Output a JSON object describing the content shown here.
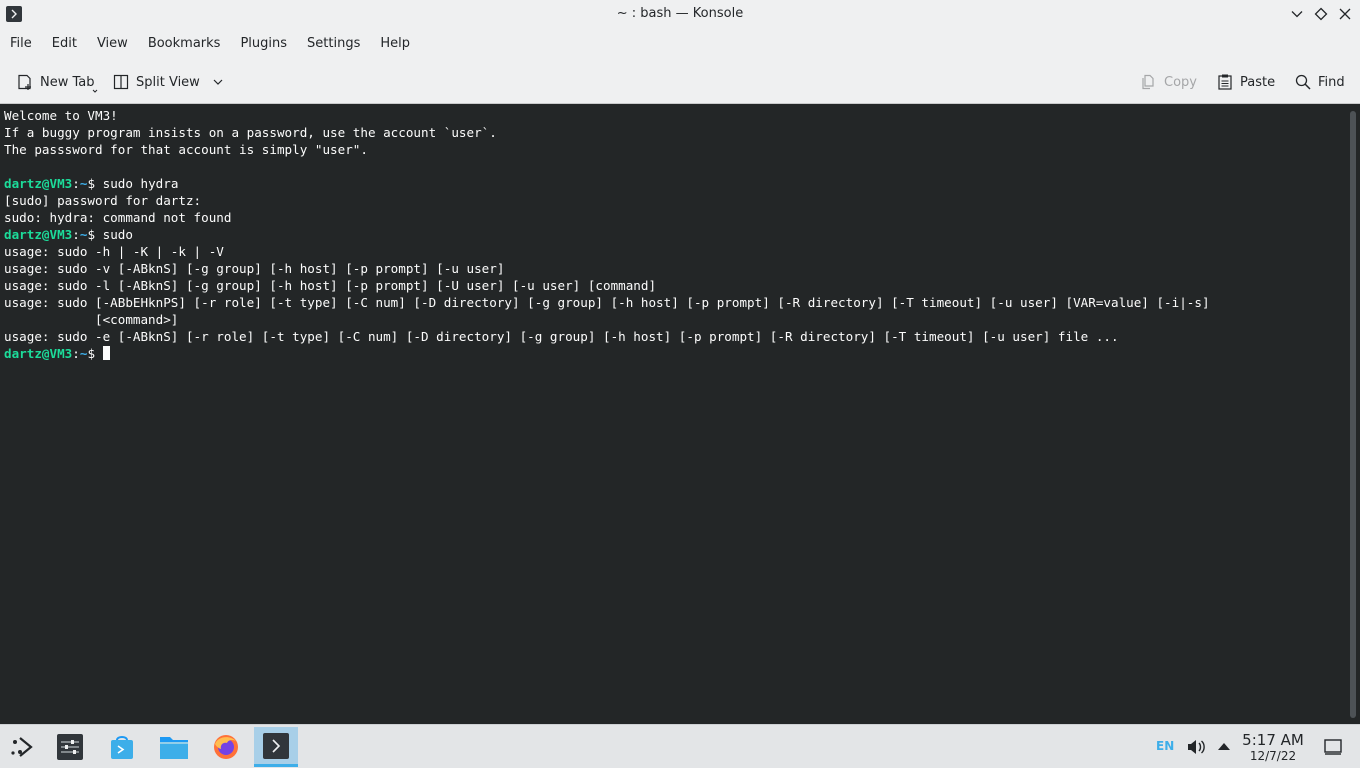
{
  "window": {
    "title": "~ : bash — Konsole"
  },
  "menubar": {
    "items": [
      "File",
      "Edit",
      "View",
      "Bookmarks",
      "Plugins",
      "Settings",
      "Help"
    ]
  },
  "toolbar": {
    "new_tab_label": "New Tab",
    "split_view_label": "Split View",
    "copy_label": "Copy",
    "paste_label": "Paste",
    "find_label": "Find"
  },
  "terminal": {
    "lines": [
      {
        "text": "Welcome to VM3!"
      },
      {
        "text": "If a buggy program insists on a password, use the account `user`."
      },
      {
        "text": "The passsword for that account is simply \"user\"."
      },
      {
        "text": ""
      },
      {
        "prompt_user": "dartz@VM3",
        "prompt_sep": ":",
        "prompt_path": "~",
        "prompt_end": "$ ",
        "text": "sudo hydra"
      },
      {
        "text": "[sudo] password for dartz:"
      },
      {
        "text": "sudo: hydra: command not found"
      },
      {
        "prompt_user": "dartz@VM3",
        "prompt_sep": ":",
        "prompt_path": "~",
        "prompt_end": "$ ",
        "text": "sudo"
      },
      {
        "text": "usage: sudo -h | -K | -k | -V"
      },
      {
        "text": "usage: sudo -v [-ABknS] [-g group] [-h host] [-p prompt] [-u user]"
      },
      {
        "text": "usage: sudo -l [-ABknS] [-g group] [-h host] [-p prompt] [-U user] [-u user] [command]"
      },
      {
        "text": "usage: sudo [-ABbEHknPS] [-r role] [-t type] [-C num] [-D directory] [-g group] [-h host] [-p prompt] [-R directory] [-T timeout] [-u user] [VAR=value] [-i|-s]"
      },
      {
        "text": "            [<command>]"
      },
      {
        "text": "usage: sudo -e [-ABknS] [-r role] [-t type] [-C num] [-D directory] [-g group] [-h host] [-p prompt] [-R directory] [-T timeout] [-u user] file ..."
      },
      {
        "prompt_user": "dartz@VM3",
        "prompt_sep": ":",
        "prompt_path": "~",
        "prompt_end": "$ ",
        "text": "",
        "cursor": true
      }
    ]
  },
  "taskbar": {
    "items": [
      {
        "icon": "application-launcher-icon"
      },
      {
        "icon": "system-settings-icon"
      },
      {
        "icon": "discover-store-icon"
      },
      {
        "icon": "file-manager-icon"
      },
      {
        "icon": "firefox-icon"
      },
      {
        "icon": "konsole-icon",
        "active": true
      }
    ],
    "keyboard_layout": "EN",
    "time": "5:17 AM",
    "date": "12/7/22"
  },
  "colors": {
    "accent": "#3daee9",
    "prompt_user": "#1cdc9a",
    "terminal_bg": "#232627",
    "terminal_fg": "#fcfcfc"
  }
}
